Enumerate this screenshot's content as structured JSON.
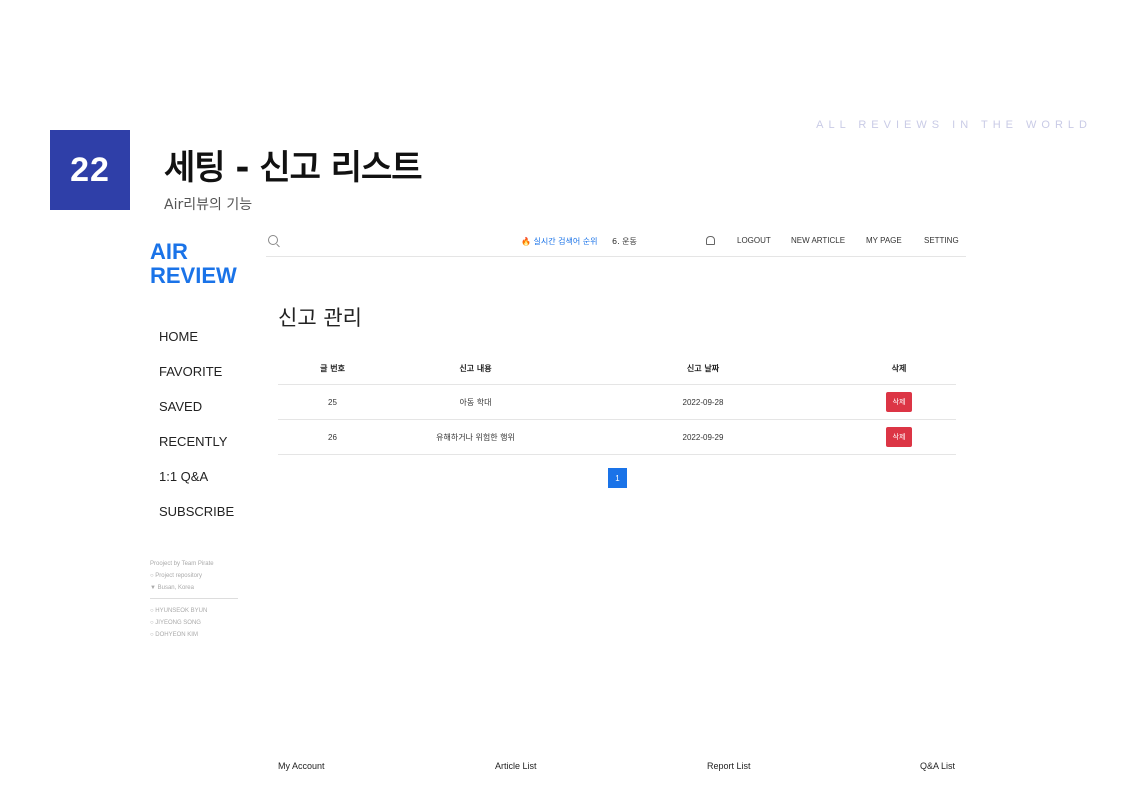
{
  "slide": {
    "number": "22",
    "title": "세팅 - 신고 리스트",
    "subtitle": "Air리뷰의 기능",
    "tagline": "ALL REVIEWS IN THE WORLD"
  },
  "app": {
    "logo_line1": "AIR",
    "logo_line2": "REVIEW",
    "sidebar": {
      "items": [
        {
          "label": "HOME"
        },
        {
          "label": "FAVORITE"
        },
        {
          "label": "SAVED"
        },
        {
          "label": "RECENTLY"
        },
        {
          "label": "1:1 Q&A"
        },
        {
          "label": "SUBSCRIBE"
        }
      ],
      "footer": {
        "project": "Prooject by Team Pirate",
        "repo": "Project repository",
        "location": "Busan, Korea",
        "members": [
          "HYUNSEOK BYUN",
          "JIYEONG SONG",
          "DOHYEON KIM"
        ]
      }
    },
    "topbar": {
      "trend_label": "실시간 검색어 순위",
      "trend_item": "6. 운동",
      "nav": [
        "LOGOUT",
        "NEW ARTICLE",
        "MY PAGE",
        "SETTING"
      ]
    },
    "main": {
      "heading": "신고 관리",
      "table": {
        "headers": [
          "글 번호",
          "신고 내용",
          "신고 날짜",
          "삭제"
        ],
        "rows": [
          {
            "id": "25",
            "content": "아동 학대",
            "date": "2022-09-28",
            "action": "삭제"
          },
          {
            "id": "26",
            "content": "유해하거나 위험한 행위",
            "date": "2022-09-29",
            "action": "삭제"
          }
        ]
      },
      "pagination": {
        "current": "1"
      }
    },
    "footer": {
      "links": [
        "My Account",
        "Article List",
        "Report List",
        "Q&A List"
      ]
    }
  },
  "colors": {
    "slide_badge": "#2f3fa8",
    "brand": "#1a73e8",
    "danger": "#dc3545"
  }
}
